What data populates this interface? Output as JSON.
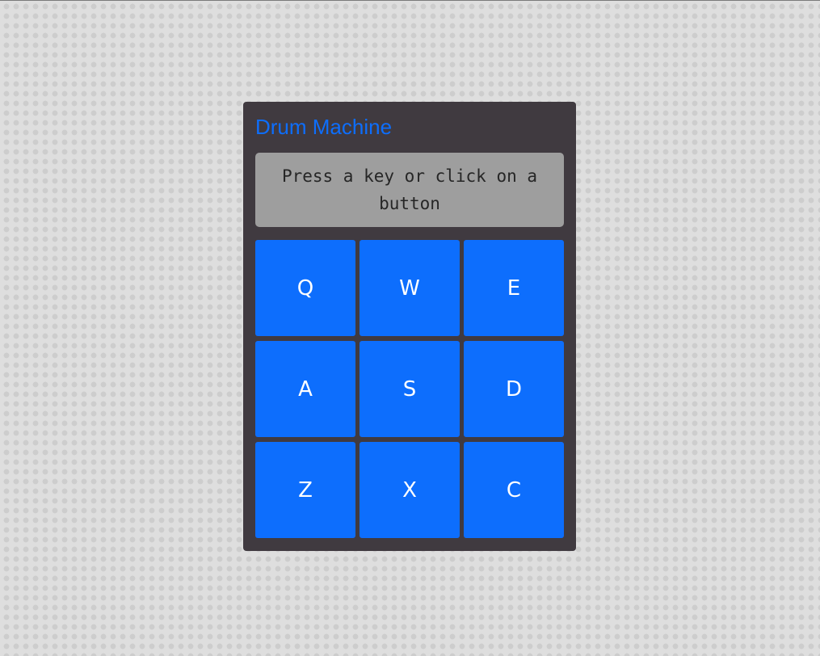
{
  "app": {
    "title": "Drum Machine"
  },
  "display": {
    "text": "Press a key or click on a button"
  },
  "pads": [
    {
      "key": "Q"
    },
    {
      "key": "W"
    },
    {
      "key": "E"
    },
    {
      "key": "A"
    },
    {
      "key": "S"
    },
    {
      "key": "D"
    },
    {
      "key": "Z"
    },
    {
      "key": "X"
    },
    {
      "key": "C"
    }
  ],
  "colors": {
    "accent": "#0d6efd",
    "panel": "#403a40",
    "display_bg": "#9e9e9e",
    "page_bg": "#dedede"
  }
}
